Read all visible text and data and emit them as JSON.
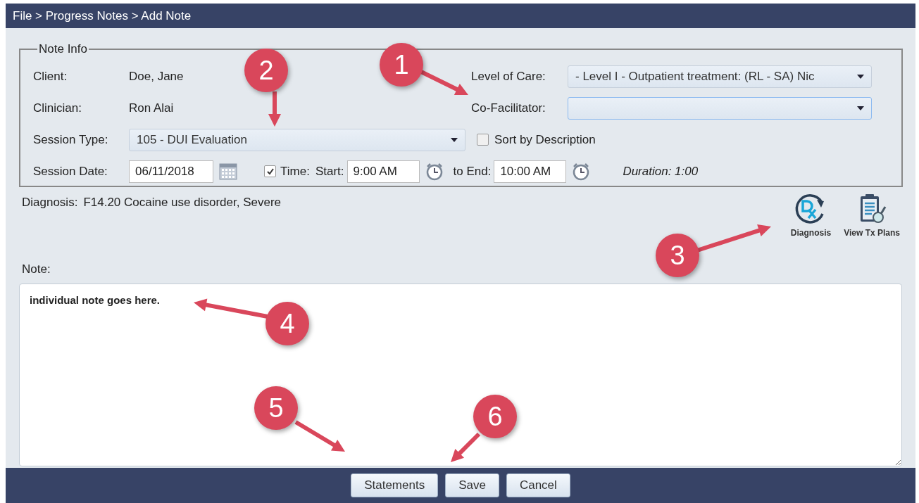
{
  "breadcrumb": "File > Progress Notes > Add Note",
  "note_info": {
    "legend": "Note Info",
    "client_label": "Client:",
    "client": "Doe, Jane",
    "clinician_label": "Clinician:",
    "clinician": "Ron Alai",
    "session_type_label": "Session Type:",
    "session_type": "105 - DUI Evaluation",
    "sort_by_description": {
      "label": "Sort by Description",
      "checked": false
    },
    "session_date_label": "Session Date:",
    "session_date": "06/11/2018",
    "time": {
      "label": "Time:",
      "checked": true
    },
    "start_label": "Start:",
    "start": "9:00 AM",
    "end_label": "to End:",
    "end": "10:00 AM",
    "duration": "Duration: 1:00",
    "level_of_care_label": "Level of Care:",
    "level_of_care": "- Level I - Outpatient treatment: (RL - SA) Nic",
    "co_facilitator_label": "Co-Facilitator:"
  },
  "diagnosis": {
    "label": "Diagnosis:",
    "value": "F14.20 Cocaine use disorder, Severe"
  },
  "tools": [
    {
      "kind": "dx",
      "label": "Diagnosis"
    },
    {
      "kind": "clipboard",
      "label": "View Tx Plans"
    }
  ],
  "note": {
    "label": "Note:",
    "value": "individual note goes here."
  },
  "buttons": [
    "Statements",
    "Save",
    "Cancel"
  ],
  "callouts": [
    "1",
    "2",
    "3",
    "4",
    "5",
    "6"
  ]
}
